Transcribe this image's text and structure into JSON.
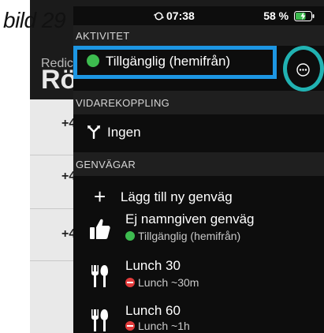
{
  "caption": "bild 29",
  "background": {
    "redirect_label": "Redic",
    "title": "Rö",
    "row_prefixes": [
      "+4",
      "+4",
      "+4"
    ]
  },
  "status_bar": {
    "time": "07:38",
    "battery": "58 %"
  },
  "sections": {
    "activity": {
      "header": "AKTIVITET",
      "current_status": "Tillgänglig (hemifrån)"
    },
    "forwarding": {
      "header": "VIDAREKOPPLING",
      "value": "Ingen"
    },
    "shortcuts": {
      "header": "GENVÄGAR",
      "add_label": "Lägg till ny genväg",
      "items": [
        {
          "title": "Ej namngiven genväg",
          "status": "Tillgänglig (hemifrån)",
          "icon": "thumbs-up-icon"
        },
        {
          "title": "Lunch 30",
          "status": "Lunch ~30m",
          "icon": "cutlery-icon"
        },
        {
          "title": "Lunch 60",
          "status": "Lunch ~1h",
          "icon": "cutlery-icon"
        }
      ]
    }
  },
  "colors": {
    "available": "#3dbb4f",
    "busy": "#e23b3b",
    "highlight_box": "#1d96e3",
    "highlight_circle": "#21b2b2"
  }
}
